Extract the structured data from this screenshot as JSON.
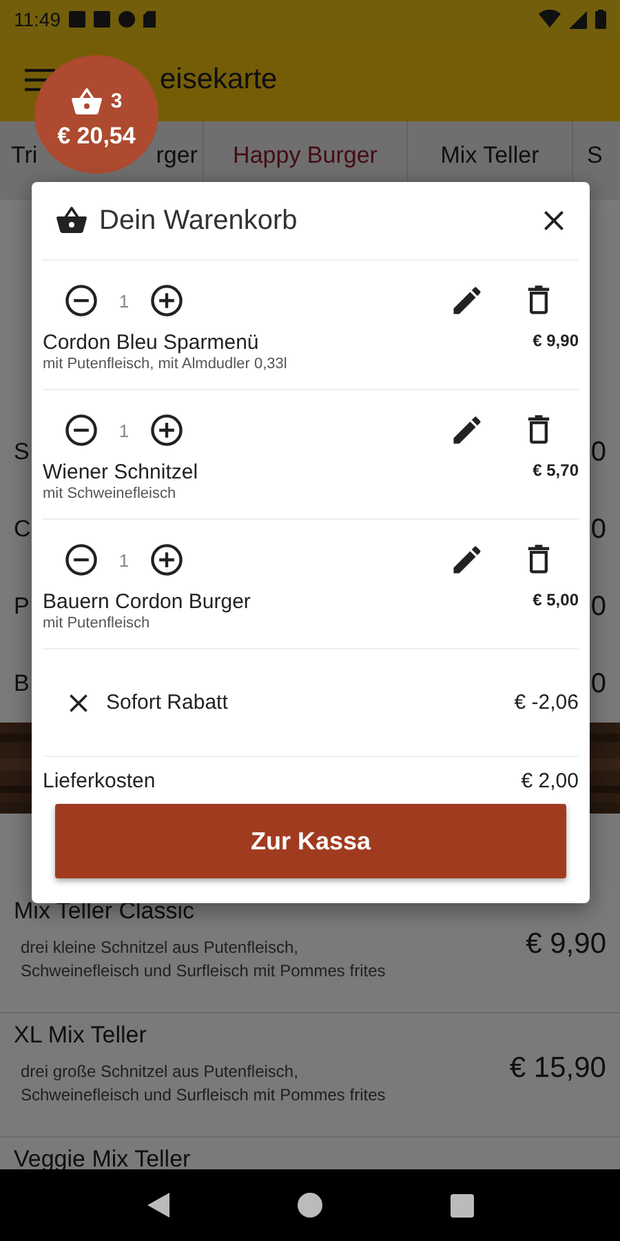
{
  "status_bar": {
    "time": "11:49"
  },
  "app_bar": {
    "title": "eisekarte"
  },
  "cart_badge": {
    "count": "3",
    "total": "€ 20,54"
  },
  "tabs": [
    {
      "label": "Tri",
      "label_tail": "rger",
      "selected": false
    },
    {
      "label": "Happy Burger",
      "selected": true
    },
    {
      "label": "Mix Teller",
      "selected": false
    },
    {
      "label": "S",
      "selected": false
    }
  ],
  "menu_rows_behind": [
    {
      "name": "S",
      "price": "0"
    },
    {
      "name": "C",
      "price": "0"
    },
    {
      "name": "P",
      "price": "0"
    },
    {
      "name": "B",
      "price": "0"
    }
  ],
  "menu_items": [
    {
      "name": "Mix Teller Classic",
      "description": "drei kleine Schnitzel aus Putenfleisch,\nSchweinefleisch und Surfleisch mit Pommes frites",
      "price": "€ 9,90"
    },
    {
      "name": "XL Mix Teller",
      "description": "drei große Schnitzel aus Putenfleisch,\nSchweinefleisch und Surfleisch mit Pommes frites",
      "price": "€ 15,90"
    },
    {
      "name": "Veggie Mix Teller"
    }
  ],
  "cart_dialog": {
    "title": "Dein Warenkorb",
    "items": [
      {
        "quantity": "1",
        "name": "Cordon Bleu Sparmenü",
        "details": "mit Putenfleisch, mit Almdudler 0,33l",
        "price": "€ 9,90"
      },
      {
        "quantity": "1",
        "name": "Wiener Schnitzel",
        "details": "mit Schweinefleisch",
        "price": "€ 5,70"
      },
      {
        "quantity": "1",
        "name": "Bauern Cordon Burger",
        "details": "mit Putenfleisch",
        "price": "€ 5,00"
      }
    ],
    "discount": {
      "label": "Sofort Rabatt",
      "amount": "€ -2,06"
    },
    "delivery": {
      "label": "Lieferkosten",
      "amount": "€ 2,00"
    },
    "checkout_button": "Zur Kassa"
  }
}
